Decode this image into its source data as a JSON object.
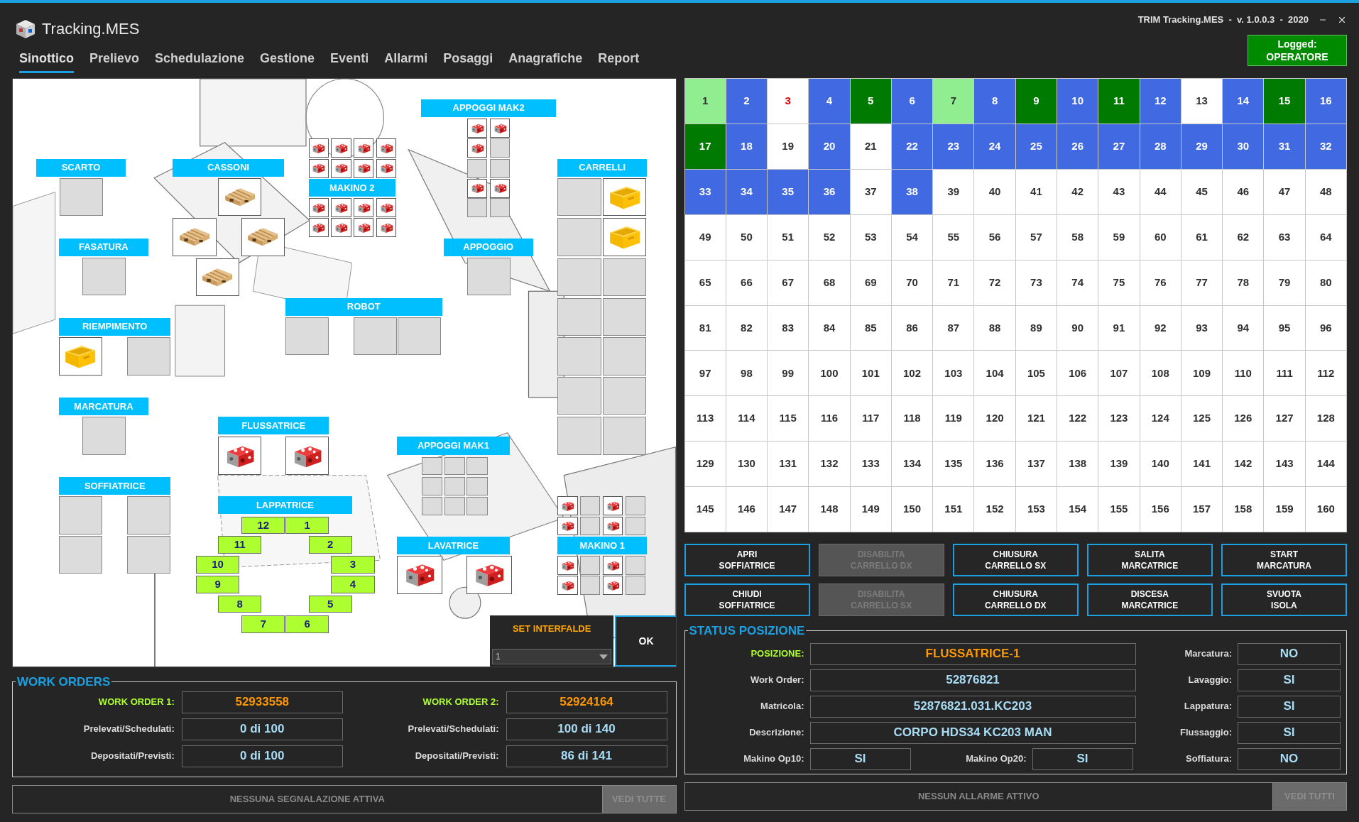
{
  "app": {
    "title": "Tracking.MES",
    "version": "TRIM Tracking.MES  -  v. 1.0.0.3  -  2020"
  },
  "logged": {
    "label": "Logged:",
    "user": "OPERATORE"
  },
  "tabs": [
    {
      "label": "Sinottico",
      "selected": true
    },
    {
      "label": "Prelievo",
      "selected": false
    },
    {
      "label": "Schedulazione",
      "selected": false
    },
    {
      "label": "Gestione",
      "selected": false
    },
    {
      "label": "Eventi",
      "selected": false
    },
    {
      "label": "Allarmi",
      "selected": false
    },
    {
      "label": "Posaggi",
      "selected": false
    },
    {
      "label": "Anagrafiche",
      "selected": false
    },
    {
      "label": "Report",
      "selected": false
    }
  ],
  "synoptic": {
    "stations": [
      {
        "label": "APPOGGI MAK2",
        "slots": [
          {
            "kind": "part"
          },
          {
            "kind": "part"
          },
          {
            "kind": "part"
          },
          {
            "kind": "empty"
          },
          {
            "kind": "empty"
          },
          {
            "kind": "empty"
          },
          {
            "kind": "part"
          },
          {
            "kind": "part"
          },
          {
            "kind": "empty"
          },
          {
            "kind": "empty"
          }
        ]
      },
      {
        "label": "SCARTO",
        "slots": [
          {
            "kind": "empty"
          }
        ]
      },
      {
        "label": "CASSONI",
        "slots": [
          {
            "kind": "pallet"
          },
          {
            "kind": "pallet"
          },
          {
            "kind": "pallet"
          },
          {
            "kind": "pallet"
          }
        ]
      },
      {
        "label": "MAKINO 2",
        "slots": [
          {
            "kind": "part"
          },
          {
            "kind": "part"
          },
          {
            "kind": "part"
          },
          {
            "kind": "part"
          },
          {
            "kind": "part"
          },
          {
            "kind": "part"
          },
          {
            "kind": "part"
          },
          {
            "kind": "part"
          },
          {
            "kind": "part"
          },
          {
            "kind": "part"
          },
          {
            "kind": "part"
          },
          {
            "kind": "part"
          },
          {
            "kind": "part"
          },
          {
            "kind": "part"
          },
          {
            "kind": "part"
          },
          {
            "kind": "part"
          }
        ]
      },
      {
        "label": "CARRELLI",
        "slots": [
          {
            "kind": "empty"
          },
          {
            "kind": "crate"
          },
          {
            "kind": "empty"
          },
          {
            "kind": "crate"
          },
          {
            "kind": "empty"
          },
          {
            "kind": "empty"
          },
          {
            "kind": "empty"
          },
          {
            "kind": "empty"
          },
          {
            "kind": "empty"
          },
          {
            "kind": "empty"
          },
          {
            "kind": "empty"
          },
          {
            "kind": "empty"
          },
          {
            "kind": "empty"
          },
          {
            "kind": "empty"
          }
        ]
      },
      {
        "label": "FASATURA",
        "slots": [
          {
            "kind": "empty"
          }
        ]
      },
      {
        "label": "APPOGGIO",
        "slots": [
          {
            "kind": "empty"
          }
        ]
      },
      {
        "label": "ROBOT",
        "slots": [
          {
            "kind": "empty"
          },
          {
            "kind": "empty"
          },
          {
            "kind": "empty"
          }
        ]
      },
      {
        "label": "RIEMPIMENTO",
        "slots": [
          {
            "kind": "crate"
          },
          {
            "kind": "empty"
          }
        ]
      },
      {
        "label": "MARCATURA",
        "slots": [
          {
            "kind": "empty"
          }
        ]
      },
      {
        "label": "FLUSSATRICE",
        "slots": [
          {
            "kind": "part"
          },
          {
            "kind": "part"
          }
        ]
      },
      {
        "label": "APPOGGI MAK1",
        "slots": [
          {
            "kind": "empty"
          },
          {
            "kind": "empty"
          },
          {
            "kind": "empty"
          },
          {
            "kind": "empty"
          },
          {
            "kind": "empty"
          },
          {
            "kind": "empty"
          },
          {
            "kind": "empty"
          },
          {
            "kind": "empty"
          },
          {
            "kind": "empty"
          }
        ]
      },
      {
        "label": "SOFFIATRICE",
        "slots": [
          {
            "kind": "empty"
          },
          {
            "kind": "empty"
          },
          {
            "kind": "empty"
          },
          {
            "kind": "empty"
          }
        ]
      },
      {
        "label": "LAPPATRICE",
        "slots": [
          {
            "kind": "numbered",
            "label": "12"
          },
          {
            "kind": "numbered",
            "label": "1"
          },
          {
            "kind": "numbered",
            "label": "11"
          },
          {
            "kind": "numbered",
            "label": "2"
          },
          {
            "kind": "numbered",
            "label": "10"
          },
          {
            "kind": "numbered",
            "label": "3"
          },
          {
            "kind": "numbered",
            "label": "9"
          },
          {
            "kind": "numbered",
            "label": "4"
          },
          {
            "kind": "numbered",
            "label": "8"
          },
          {
            "kind": "numbered",
            "label": "5"
          },
          {
            "kind": "numbered",
            "label": "7"
          },
          {
            "kind": "numbered",
            "label": "6"
          }
        ]
      },
      {
        "label": "LAVATRICE",
        "slots": [
          {
            "kind": "part"
          },
          {
            "kind": "part"
          }
        ]
      },
      {
        "label": "MAKINO 1",
        "slots": [
          {
            "kind": "part"
          },
          {
            "kind": "empty"
          },
          {
            "kind": "part"
          },
          {
            "kind": "empty"
          },
          {
            "kind": "part"
          },
          {
            "kind": "empty"
          },
          {
            "kind": "part"
          },
          {
            "kind": "empty"
          },
          {
            "kind": "part"
          },
          {
            "kind": "empty"
          },
          {
            "kind": "part"
          },
          {
            "kind": "empty"
          },
          {
            "kind": "part"
          },
          {
            "kind": "empty"
          },
          {
            "kind": "part"
          },
          {
            "kind": "empty"
          }
        ]
      }
    ],
    "interfalde": {
      "label": "SET INTERFALDE",
      "value": "1"
    },
    "ok_button": "OK"
  },
  "work_orders": {
    "title": "WORK ORDERS",
    "orders": [
      {
        "rows": [
          {
            "label": "WORK ORDER 1:",
            "value": "52933558",
            "kind": "highlight"
          },
          {
            "label": "Prelevati/Schedulati:",
            "value": "0 di 100",
            "kind": "normal"
          },
          {
            "label": "Depositati/Previsti:",
            "value": "0 di 100",
            "kind": "normal"
          }
        ]
      },
      {
        "rows": [
          {
            "label": "WORK ORDER 2:",
            "value": "52924164",
            "kind": "highlight"
          },
          {
            "label": "Prelevati/Schedulati:",
            "value": "100 di 140",
            "kind": "normal"
          },
          {
            "label": "Depositati/Previsti:",
            "value": "86 di 141",
            "kind": "normal"
          }
        ]
      }
    ]
  },
  "signals_bar": {
    "message": "NESSUNA SEGNALAZIONE ATTIVA",
    "button": "VEDI TUTTE",
    "button_disabled": true
  },
  "grid": {
    "cells": [
      {
        "label": "1",
        "color": "#90ee90",
        "kind": "normal"
      },
      {
        "label": "2",
        "color": "#4169e1",
        "kind": "normal"
      },
      {
        "label": "3",
        "color": "#ffffff",
        "kind": "alert"
      },
      {
        "label": "4",
        "color": "#4169e1",
        "kind": "normal"
      },
      {
        "label": "5",
        "color": "#007a00",
        "kind": "normal"
      },
      {
        "label": "6",
        "color": "#4169e1",
        "kind": "normal"
      },
      {
        "label": "7",
        "color": "#90ee90",
        "kind": "normal"
      },
      {
        "label": "8",
        "color": "#4169e1",
        "kind": "normal"
      },
      {
        "label": "9",
        "color": "#007a00",
        "kind": "normal"
      },
      {
        "label": "10",
        "color": "#4169e1",
        "kind": "normal"
      },
      {
        "label": "11",
        "color": "#007a00",
        "kind": "normal"
      },
      {
        "label": "12",
        "color": "#4169e1",
        "kind": "normal"
      },
      {
        "label": "13",
        "color": "#ffffff",
        "kind": "normal"
      },
      {
        "label": "14",
        "color": "#4169e1",
        "kind": "normal"
      },
      {
        "label": "15",
        "color": "#007a00",
        "kind": "normal"
      },
      {
        "label": "16",
        "color": "#4169e1",
        "kind": "normal"
      },
      {
        "label": "17",
        "color": "#007a00",
        "kind": "normal"
      },
      {
        "label": "18",
        "color": "#4169e1",
        "kind": "normal"
      },
      {
        "label": "19",
        "color": "#ffffff",
        "kind": "normal"
      },
      {
        "label": "20",
        "color": "#4169e1",
        "kind": "normal"
      },
      {
        "label": "21",
        "color": "#ffffff",
        "kind": "normal"
      },
      {
        "label": "22",
        "color": "#4169e1",
        "kind": "normal"
      },
      {
        "label": "23",
        "color": "#4169e1",
        "kind": "normal"
      },
      {
        "label": "24",
        "color": "#4169e1",
        "kind": "normal"
      },
      {
        "label": "25",
        "color": "#4169e1",
        "kind": "normal"
      },
      {
        "label": "26",
        "color": "#4169e1",
        "kind": "normal"
      },
      {
        "label": "27",
        "color": "#4169e1",
        "kind": "normal"
      },
      {
        "label": "28",
        "color": "#4169e1",
        "kind": "normal"
      },
      {
        "label": "29",
        "color": "#4169e1",
        "kind": "normal"
      },
      {
        "label": "30",
        "color": "#4169e1",
        "kind": "normal"
      },
      {
        "label": "31",
        "color": "#4169e1",
        "kind": "normal"
      },
      {
        "label": "32",
        "color": "#4169e1",
        "kind": "normal"
      },
      {
        "label": "33",
        "color": "#4169e1",
        "kind": "normal"
      },
      {
        "label": "34",
        "color": "#4169e1",
        "kind": "normal"
      },
      {
        "label": "35",
        "color": "#4169e1",
        "kind": "normal"
      },
      {
        "label": "36",
        "color": "#4169e1",
        "kind": "normal"
      },
      {
        "label": "37",
        "color": "#ffffff",
        "kind": "normal"
      },
      {
        "label": "38",
        "color": "#4169e1",
        "kind": "normal"
      },
      {
        "label": "39",
        "color": "#ffffff",
        "kind": "normal"
      },
      {
        "label": "40",
        "color": "#ffffff",
        "kind": "normal"
      },
      {
        "label": "41",
        "color": "#ffffff",
        "kind": "normal"
      },
      {
        "label": "42",
        "color": "#ffffff",
        "kind": "normal"
      },
      {
        "label": "43",
        "color": "#ffffff",
        "kind": "normal"
      },
      {
        "label": "44",
        "color": "#ffffff",
        "kind": "normal"
      },
      {
        "label": "45",
        "color": "#ffffff",
        "kind": "normal"
      },
      {
        "label": "46",
        "color": "#ffffff",
        "kind": "normal"
      },
      {
        "label": "47",
        "color": "#ffffff",
        "kind": "normal"
      },
      {
        "label": "48",
        "color": "#ffffff",
        "kind": "normal"
      },
      {
        "label": "49",
        "color": "#ffffff",
        "kind": "normal"
      },
      {
        "label": "50",
        "color": "#ffffff",
        "kind": "normal"
      },
      {
        "label": "51",
        "color": "#ffffff",
        "kind": "normal"
      },
      {
        "label": "52",
        "color": "#ffffff",
        "kind": "normal"
      },
      {
        "label": "53",
        "color": "#ffffff",
        "kind": "normal"
      },
      {
        "label": "54",
        "color": "#ffffff",
        "kind": "normal"
      },
      {
        "label": "55",
        "color": "#ffffff",
        "kind": "normal"
      },
      {
        "label": "56",
        "color": "#ffffff",
        "kind": "normal"
      },
      {
        "label": "57",
        "color": "#ffffff",
        "kind": "normal"
      },
      {
        "label": "58",
        "color": "#ffffff",
        "kind": "normal"
      },
      {
        "label": "59",
        "color": "#ffffff",
        "kind": "normal"
      },
      {
        "label": "60",
        "color": "#ffffff",
        "kind": "normal"
      },
      {
        "label": "61",
        "color": "#ffffff",
        "kind": "normal"
      },
      {
        "label": "62",
        "color": "#ffffff",
        "kind": "normal"
      },
      {
        "label": "63",
        "color": "#ffffff",
        "kind": "normal"
      },
      {
        "label": "64",
        "color": "#ffffff",
        "kind": "normal"
      },
      {
        "label": "65",
        "color": "#ffffff",
        "kind": "normal"
      },
      {
        "label": "66",
        "color": "#ffffff",
        "kind": "normal"
      },
      {
        "label": "67",
        "color": "#ffffff",
        "kind": "normal"
      },
      {
        "label": "68",
        "color": "#ffffff",
        "kind": "normal"
      },
      {
        "label": "69",
        "color": "#ffffff",
        "kind": "normal"
      },
      {
        "label": "70",
        "color": "#ffffff",
        "kind": "normal"
      },
      {
        "label": "71",
        "color": "#ffffff",
        "kind": "normal"
      },
      {
        "label": "72",
        "color": "#ffffff",
        "kind": "normal"
      },
      {
        "label": "73",
        "color": "#ffffff",
        "kind": "normal"
      },
      {
        "label": "74",
        "color": "#ffffff",
        "kind": "normal"
      },
      {
        "label": "75",
        "color": "#ffffff",
        "kind": "normal"
      },
      {
        "label": "76",
        "color": "#ffffff",
        "kind": "normal"
      },
      {
        "label": "77",
        "color": "#ffffff",
        "kind": "normal"
      },
      {
        "label": "78",
        "color": "#ffffff",
        "kind": "normal"
      },
      {
        "label": "79",
        "color": "#ffffff",
        "kind": "normal"
      },
      {
        "label": "80",
        "color": "#ffffff",
        "kind": "normal"
      },
      {
        "label": "81",
        "color": "#ffffff",
        "kind": "normal"
      },
      {
        "label": "82",
        "color": "#ffffff",
        "kind": "normal"
      },
      {
        "label": "83",
        "color": "#ffffff",
        "kind": "normal"
      },
      {
        "label": "84",
        "color": "#ffffff",
        "kind": "normal"
      },
      {
        "label": "85",
        "color": "#ffffff",
        "kind": "normal"
      },
      {
        "label": "86",
        "color": "#ffffff",
        "kind": "normal"
      },
      {
        "label": "87",
        "color": "#ffffff",
        "kind": "normal"
      },
      {
        "label": "88",
        "color": "#ffffff",
        "kind": "normal"
      },
      {
        "label": "89",
        "color": "#ffffff",
        "kind": "normal"
      },
      {
        "label": "90",
        "color": "#ffffff",
        "kind": "normal"
      },
      {
        "label": "91",
        "color": "#ffffff",
        "kind": "normal"
      },
      {
        "label": "92",
        "color": "#ffffff",
        "kind": "normal"
      },
      {
        "label": "93",
        "color": "#ffffff",
        "kind": "normal"
      },
      {
        "label": "94",
        "color": "#ffffff",
        "kind": "normal"
      },
      {
        "label": "95",
        "color": "#ffffff",
        "kind": "normal"
      },
      {
        "label": "96",
        "color": "#ffffff",
        "kind": "normal"
      },
      {
        "label": "97",
        "color": "#ffffff",
        "kind": "normal"
      },
      {
        "label": "98",
        "color": "#ffffff",
        "kind": "normal"
      },
      {
        "label": "99",
        "color": "#ffffff",
        "kind": "normal"
      },
      {
        "label": "100",
        "color": "#ffffff",
        "kind": "normal"
      },
      {
        "label": "101",
        "color": "#ffffff",
        "kind": "normal"
      },
      {
        "label": "102",
        "color": "#ffffff",
        "kind": "normal"
      },
      {
        "label": "103",
        "color": "#ffffff",
        "kind": "normal"
      },
      {
        "label": "104",
        "color": "#ffffff",
        "kind": "normal"
      },
      {
        "label": "105",
        "color": "#ffffff",
        "kind": "normal"
      },
      {
        "label": "106",
        "color": "#ffffff",
        "kind": "normal"
      },
      {
        "label": "107",
        "color": "#ffffff",
        "kind": "normal"
      },
      {
        "label": "108",
        "color": "#ffffff",
        "kind": "normal"
      },
      {
        "label": "109",
        "color": "#ffffff",
        "kind": "normal"
      },
      {
        "label": "110",
        "color": "#ffffff",
        "kind": "normal"
      },
      {
        "label": "111",
        "color": "#ffffff",
        "kind": "normal"
      },
      {
        "label": "112",
        "color": "#ffffff",
        "kind": "normal"
      },
      {
        "label": "113",
        "color": "#ffffff",
        "kind": "normal"
      },
      {
        "label": "114",
        "color": "#ffffff",
        "kind": "normal"
      },
      {
        "label": "115",
        "color": "#ffffff",
        "kind": "normal"
      },
      {
        "label": "116",
        "color": "#ffffff",
        "kind": "normal"
      },
      {
        "label": "117",
        "color": "#ffffff",
        "kind": "normal"
      },
      {
        "label": "118",
        "color": "#ffffff",
        "kind": "normal"
      },
      {
        "label": "119",
        "color": "#ffffff",
        "kind": "normal"
      },
      {
        "label": "120",
        "color": "#ffffff",
        "kind": "normal"
      },
      {
        "label": "121",
        "color": "#ffffff",
        "kind": "normal"
      },
      {
        "label": "122",
        "color": "#ffffff",
        "kind": "normal"
      },
      {
        "label": "123",
        "color": "#ffffff",
        "kind": "normal"
      },
      {
        "label": "124",
        "color": "#ffffff",
        "kind": "normal"
      },
      {
        "label": "125",
        "color": "#ffffff",
        "kind": "normal"
      },
      {
        "label": "126",
        "color": "#ffffff",
        "kind": "normal"
      },
      {
        "label": "127",
        "color": "#ffffff",
        "kind": "normal"
      },
      {
        "label": "128",
        "color": "#ffffff",
        "kind": "normal"
      },
      {
        "label": "129",
        "color": "#ffffff",
        "kind": "normal"
      },
      {
        "label": "130",
        "color": "#ffffff",
        "kind": "normal"
      },
      {
        "label": "131",
        "color": "#ffffff",
        "kind": "normal"
      },
      {
        "label": "132",
        "color": "#ffffff",
        "kind": "normal"
      },
      {
        "label": "133",
        "color": "#ffffff",
        "kind": "normal"
      },
      {
        "label": "134",
        "color": "#ffffff",
        "kind": "normal"
      },
      {
        "label": "135",
        "color": "#ffffff",
        "kind": "normal"
      },
      {
        "label": "136",
        "color": "#ffffff",
        "kind": "normal"
      },
      {
        "label": "137",
        "color": "#ffffff",
        "kind": "normal"
      },
      {
        "label": "138",
        "color": "#ffffff",
        "kind": "normal"
      },
      {
        "label": "139",
        "color": "#ffffff",
        "kind": "normal"
      },
      {
        "label": "140",
        "color": "#ffffff",
        "kind": "normal"
      },
      {
        "label": "141",
        "color": "#ffffff",
        "kind": "normal"
      },
      {
        "label": "142",
        "color": "#ffffff",
        "kind": "normal"
      },
      {
        "label": "143",
        "color": "#ffffff",
        "kind": "normal"
      },
      {
        "label": "144",
        "color": "#ffffff",
        "kind": "normal"
      },
      {
        "label": "145",
        "color": "#ffffff",
        "kind": "normal"
      },
      {
        "label": "146",
        "color": "#ffffff",
        "kind": "normal"
      },
      {
        "label": "147",
        "color": "#ffffff",
        "kind": "normal"
      },
      {
        "label": "148",
        "color": "#ffffff",
        "kind": "normal"
      },
      {
        "label": "149",
        "color": "#ffffff",
        "kind": "normal"
      },
      {
        "label": "150",
        "color": "#ffffff",
        "kind": "normal"
      },
      {
        "label": "151",
        "color": "#ffffff",
        "kind": "normal"
      },
      {
        "label": "152",
        "color": "#ffffff",
        "kind": "normal"
      },
      {
        "label": "153",
        "color": "#ffffff",
        "kind": "normal"
      },
      {
        "label": "154",
        "color": "#ffffff",
        "kind": "normal"
      },
      {
        "label": "155",
        "color": "#ffffff",
        "kind": "normal"
      },
      {
        "label": "156",
        "color": "#ffffff",
        "kind": "normal"
      },
      {
        "label": "157",
        "color": "#ffffff",
        "kind": "normal"
      },
      {
        "label": "158",
        "color": "#ffffff",
        "kind": "normal"
      },
      {
        "label": "159",
        "color": "#ffffff",
        "kind": "normal"
      },
      {
        "label": "160",
        "color": "#ffffff",
        "kind": "normal"
      }
    ]
  },
  "buttons": [
    {
      "label": "APRI\nSOFFIATRICE",
      "disabled": false
    },
    {
      "label": "DISABILITA\nCARRELLO DX",
      "disabled": true
    },
    {
      "label": "CHIUSURA\nCARRELLO SX",
      "disabled": false
    },
    {
      "label": "SALITA\nMARCATRICE",
      "disabled": false
    },
    {
      "label": "START\nMARCATURA",
      "disabled": false
    },
    {
      "label": "CHIUDI\nSOFFIATRICE",
      "disabled": false
    },
    {
      "label": "DISABILITA\nCARRELLO SX",
      "disabled": true
    },
    {
      "label": "CHIUSURA\nCARRELLO DX",
      "disabled": false
    },
    {
      "label": "DISCESA\nMARCATRICE",
      "disabled": false
    },
    {
      "label": "SVUOTA\nISOLA",
      "disabled": false
    }
  ],
  "status_posizione": {
    "title": "STATUS POSIZIONE",
    "fields": [
      {
        "label": "POSIZIONE:",
        "value": "FLUSSATRICE-1",
        "kind": "highlight"
      },
      {
        "label": "Work Order:",
        "value": "52876821",
        "kind": "normal"
      },
      {
        "label": "Matricola:",
        "value": "52876821.031.KC203",
        "kind": "normal"
      },
      {
        "label": "Descrizione:",
        "value": "CORPO HDS34 KC203 MAN",
        "kind": "normal"
      }
    ],
    "makino": [
      {
        "label": "Makino Op10:",
        "value": "SI"
      },
      {
        "label": "Makino Op20:",
        "value": "SI"
      }
    ],
    "flags": [
      {
        "label": "Marcatura:",
        "value": "NO"
      },
      {
        "label": "Lavaggio:",
        "value": "SI"
      },
      {
        "label": "Lappatura:",
        "value": "SI"
      },
      {
        "label": "Flussaggio:",
        "value": "SI"
      },
      {
        "label": "Soffiatura:",
        "value": "NO"
      }
    ]
  },
  "alarms_bar": {
    "message": "NESSUN ALLARME ATTIVO",
    "button": "VEDI TUTTI",
    "button_disabled": true
  }
}
